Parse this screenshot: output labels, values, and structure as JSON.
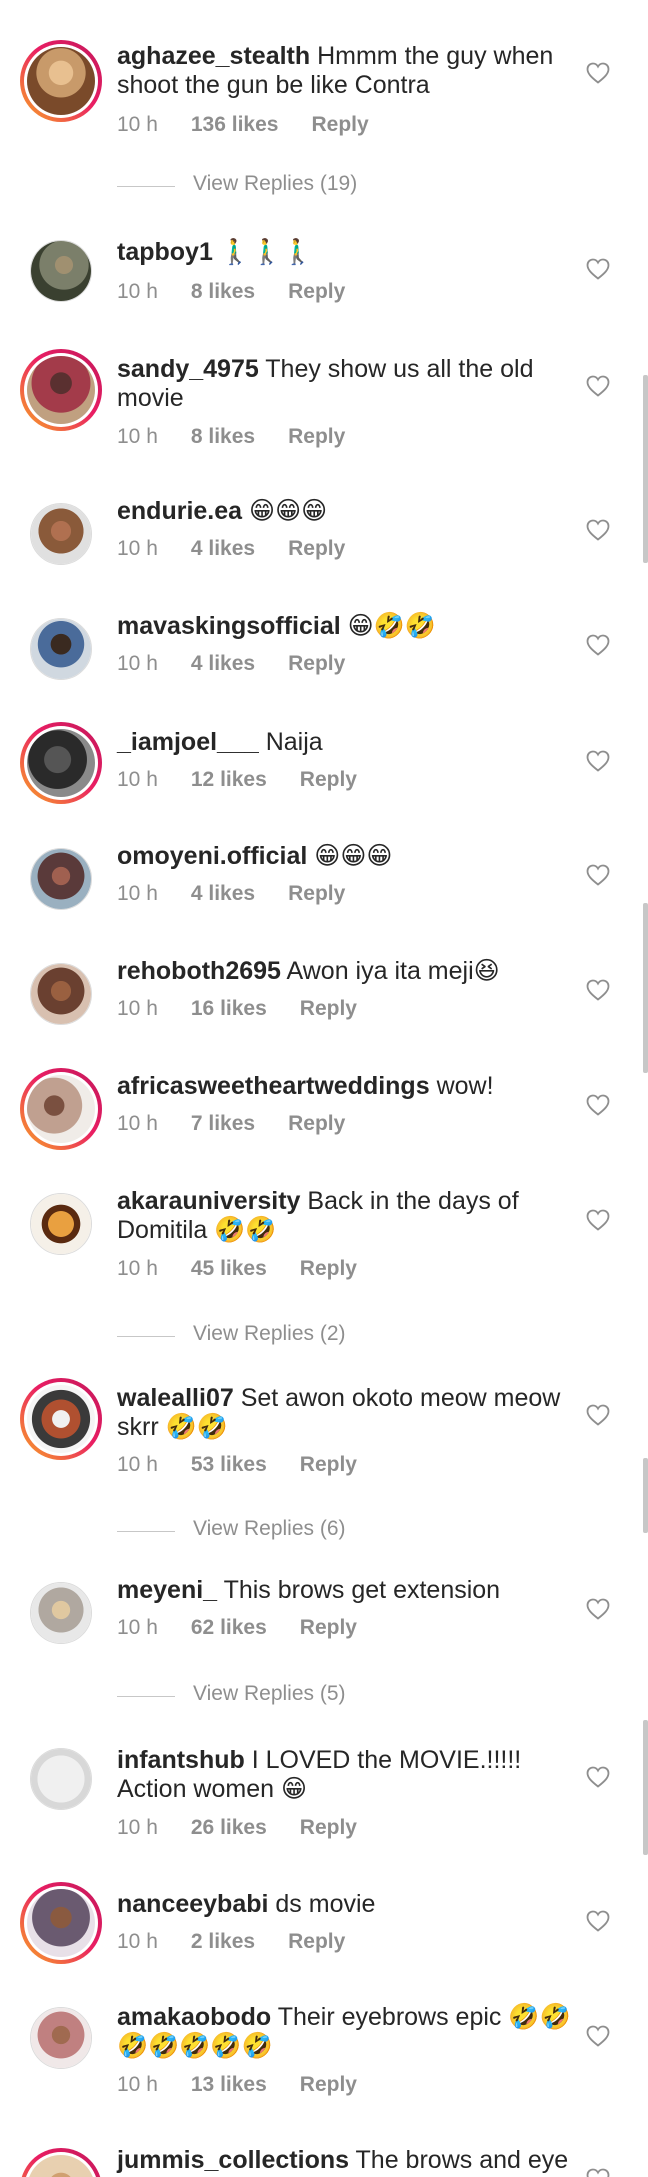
{
  "comments": [
    {
      "user": "aghazee_stealth",
      "text": "Hmmm the guy when shoot the gun be like Contra",
      "time": "10 h",
      "likes": "136 likes",
      "reply": "Reply",
      "view_replies": "View Replies (19)",
      "avatar_color": "#c89a6a"
    },
    {
      "user": "tapboy1",
      "text": "🚶‍♂️🚶‍♂️🚶‍♂️",
      "time": "10 h",
      "likes": "8 likes",
      "reply": "Reply",
      "avatar_color": "#7b7f6a"
    },
    {
      "user": "sandy_4975",
      "text": "They show us all the old movie",
      "time": "10 h",
      "likes": "8 likes",
      "reply": "Reply",
      "avatar_color": "#a33b4a"
    },
    {
      "user": "endurie.ea",
      "text": "😁😁😁",
      "time": "10 h",
      "likes": "4 likes",
      "reply": "Reply",
      "avatar_color": "#8a5a3a"
    },
    {
      "user": "mavaskingsofficial",
      "text": "😁🤣🤣",
      "time": "10 h",
      "likes": "4 likes",
      "reply": "Reply",
      "avatar_color": "#4a6b9a"
    },
    {
      "user": "_iamjoel___",
      "text": "Naija",
      "time": "10 h",
      "likes": "12 likes",
      "reply": "Reply",
      "avatar_color": "#2a2a2a"
    },
    {
      "user": "omoyeni.official",
      "text": "😁😁😁",
      "time": "10 h",
      "likes": "4 likes",
      "reply": "Reply",
      "avatar_color": "#5a3a3a"
    },
    {
      "user": "rehoboth2695",
      "text": "Awon iya ita meji😆",
      "time": "10 h",
      "likes": "16 likes",
      "reply": "Reply",
      "avatar_color": "#6a4030"
    },
    {
      "user": "africasweetheartweddings",
      "text": "wow!",
      "time": "10 h",
      "likes": "7 likes",
      "reply": "Reply",
      "avatar_color": "#c0a090"
    },
    {
      "user": "akarauniversity",
      "text": "Back in the days of Domitila 🤣🤣",
      "time": "10 h",
      "likes": "45 likes",
      "reply": "Reply",
      "view_replies": "View Replies (2)",
      "avatar_color": "#e9a040"
    },
    {
      "user": "walealli07",
      "text": "Set awon okoto meow meow skrr 🤣🤣",
      "time": "10 h",
      "likes": "53 likes",
      "reply": "Reply",
      "view_replies": "View Replies (6)",
      "avatar_color": "#b05030"
    },
    {
      "user": "meyeni_",
      "text": "This brows get extension",
      "time": "10 h",
      "likes": "62 likes",
      "reply": "Reply",
      "view_replies": "View Replies (5)",
      "avatar_color": "#b0a8a0"
    },
    {
      "user": "infantshub",
      "text": "I LOVED the MOVIE.!!!!! Action women 😁",
      "time": "10 h",
      "likes": "26 likes",
      "reply": "Reply",
      "avatar_color": "#e8e8e8"
    },
    {
      "user": "nanceeybabi",
      "text": "ds movie",
      "time": "10 h",
      "likes": "2 likes",
      "reply": "Reply",
      "avatar_color": "#6a5a70"
    },
    {
      "user": "amakaobodo",
      "text": "Their eyebrows epic 🤣🤣🤣🤣🤣🤣🤣",
      "time": "10 h",
      "likes": "13 likes",
      "reply": "Reply",
      "avatar_color": "#c08080"
    },
    {
      "user": "jummis_collections",
      "text": "The brows and eye",
      "avatar_color": "#d0a070"
    }
  ],
  "icons": {
    "heart": "heart-icon"
  },
  "colors": {
    "meta": "#8e8e8e",
    "ring_start": "#f9a825",
    "ring_end": "#c2185b"
  }
}
